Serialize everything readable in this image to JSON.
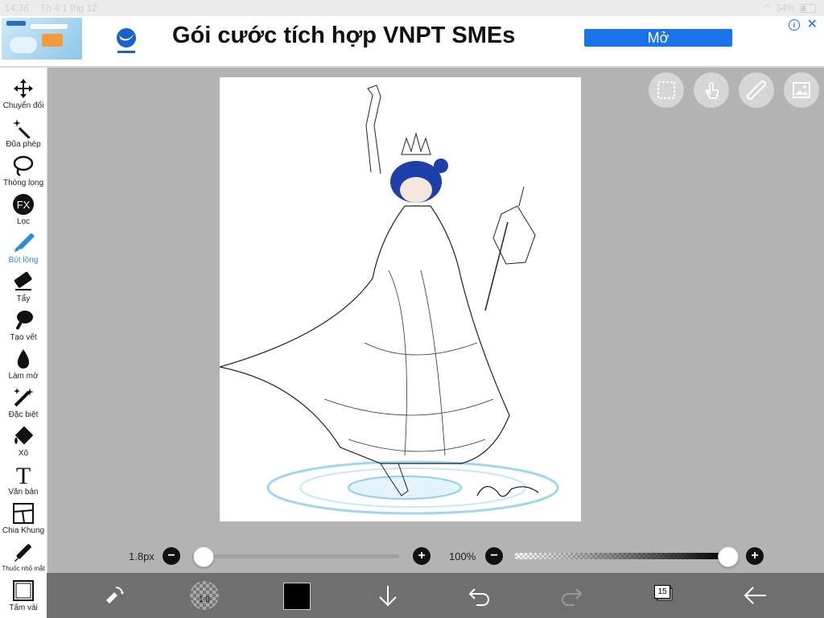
{
  "status_bar": {
    "time": "14:36",
    "date": "Th 4 1 thg 12",
    "battery": "34%"
  },
  "ad": {
    "title": "Gói cước tích hợp VNPT SMEs",
    "open_button": "Mở",
    "info_icon": "info-icon",
    "close_icon": "close-icon",
    "accent": "#1a73e8"
  },
  "toolbar": {
    "items": [
      {
        "label": "Chuyển đổi",
        "icon": "move-icon"
      },
      {
        "label": "Đũa phép",
        "icon": "magic-wand-icon"
      },
      {
        "label": "Thòng lọng",
        "icon": "lasso-icon"
      },
      {
        "label": "Lọc",
        "icon": "fx-filter-icon"
      },
      {
        "label": "Bút lông",
        "icon": "brush-icon",
        "active": true
      },
      {
        "label": "Tẩy",
        "icon": "eraser-icon"
      },
      {
        "label": "Tạo vết",
        "icon": "smudge-icon"
      },
      {
        "label": "Làm mờ",
        "icon": "blur-drop-icon"
      },
      {
        "label": "Đặc biệt",
        "icon": "sparkle-icon"
      },
      {
        "label": "Xô",
        "icon": "bucket-icon"
      },
      {
        "label": "Văn bản",
        "icon": "text-icon"
      },
      {
        "label": "Chia Khung",
        "icon": "frame-divide-icon"
      },
      {
        "label": "Thuốc nhỏ mắt",
        "icon": "eyedropper-icon"
      },
      {
        "label": "Tấm vải",
        "icon": "canvas-icon"
      }
    ],
    "active_color": "#2e8bd8"
  },
  "quick_actions": [
    "selection-icon",
    "touch-icon",
    "ruler-icon",
    "image-icon"
  ],
  "brush_size": {
    "label": "1.8px",
    "value_fraction": 0.0
  },
  "opacity": {
    "label": "100%",
    "value_fraction": 1.0
  },
  "bottom_bar": {
    "brush_preview_value": "1.8",
    "current_color": "#000000",
    "layer_count": "15",
    "icons": [
      "swap-color-icon",
      "brush-preview-icon",
      "color-swatch",
      "download-icon",
      "undo-icon",
      "redo-icon",
      "layers-icon",
      "back-arrow-icon"
    ]
  }
}
